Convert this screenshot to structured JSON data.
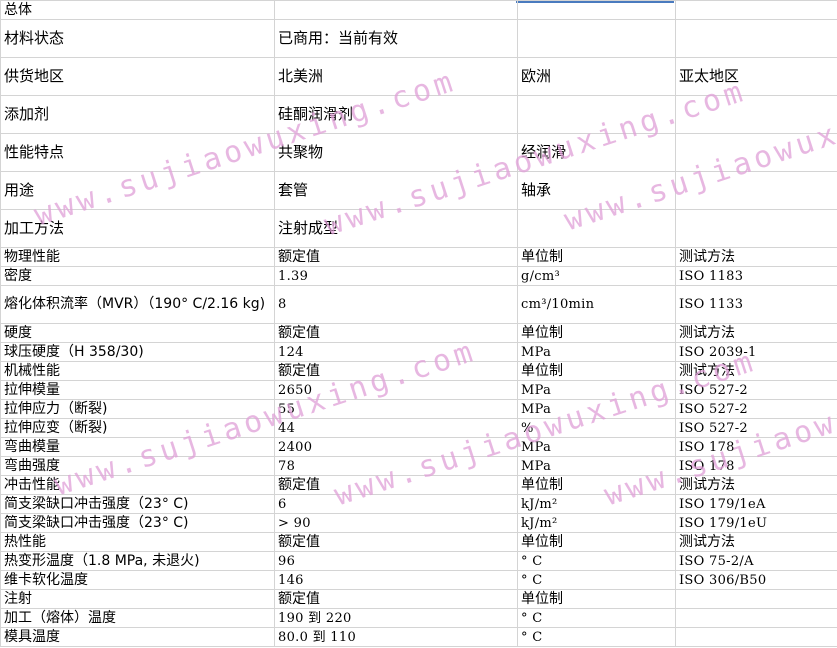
{
  "watermark": "www.sujiaowuxing.com",
  "rows": [
    {
      "cells": [
        "总体",
        "",
        "",
        ""
      ]
    },
    {
      "cells": [
        "材料状态",
        "已商用：当前有效",
        "",
        ""
      ]
    },
    {
      "cells": [
        "供货地区",
        "北美洲",
        "欧洲",
        "亚太地区"
      ]
    },
    {
      "cells": [
        "添加剂",
        "硅酮润滑剂",
        "",
        ""
      ]
    },
    {
      "cells": [
        "性能特点",
        "共聚物",
        "经润滑",
        ""
      ]
    },
    {
      "cells": [
        "用途",
        "套管",
        "轴承",
        ""
      ]
    },
    {
      "cells": [
        "加工方法",
        "注射成型",
        "",
        ""
      ]
    },
    {
      "cells": [
        "物理性能",
        "额定值",
        "单位制",
        "测试方法"
      ]
    },
    {
      "cells": [
        "密度",
        "1.39",
        "g/cm³",
        "ISO 1183"
      ]
    },
    {
      "cells": [
        "熔化体积流率（MVR）（190° C/2.16 kg)",
        "8",
        "cm³/10min",
        "ISO 1133"
      ]
    },
    {
      "cells": [
        "硬度",
        "额定值",
        "单位制",
        "测试方法"
      ]
    },
    {
      "cells": [
        "球压硬度（H 358/30)",
        "124",
        "MPa",
        "ISO 2039-1"
      ]
    },
    {
      "cells": [
        "机械性能",
        "额定值",
        "单位制",
        "测试方法"
      ]
    },
    {
      "cells": [
        "拉伸模量",
        "2650",
        "MPa",
        "ISO 527-2"
      ]
    },
    {
      "cells": [
        "拉伸应力（断裂)",
        "55",
        "MPa",
        "ISO 527-2"
      ]
    },
    {
      "cells": [
        "拉伸应变（断裂)",
        "44",
        "%",
        "ISO 527-2"
      ]
    },
    {
      "cells": [
        "弯曲模量",
        "2400",
        "MPa",
        "ISO 178"
      ]
    },
    {
      "cells": [
        "弯曲强度",
        "78",
        "MPa",
        "ISO 178"
      ]
    },
    {
      "cells": [
        "冲击性能",
        "额定值",
        "单位制",
        "测试方法"
      ]
    },
    {
      "cells": [
        "简支梁缺口冲击强度（23° C)",
        "6",
        "kJ/m²",
        "ISO 179/1eA"
      ]
    },
    {
      "cells": [
        "简支梁缺口冲击强度（23° C)",
        "> 90",
        "kJ/m²",
        "ISO 179/1eU"
      ]
    },
    {
      "cells": [
        "热性能",
        "额定值",
        "单位制",
        "测试方法"
      ]
    },
    {
      "cells": [
        "热变形温度（1.8 MPa, 未退火)",
        "96",
        "° C",
        "ISO 75-2/A"
      ]
    },
    {
      "cells": [
        "维卡软化温度",
        "146",
        "° C",
        "ISO 306/B50"
      ]
    },
    {
      "cells": [
        "注射",
        "额定值",
        "单位制",
        ""
      ]
    },
    {
      "cells": [
        "加工（熔体）温度",
        "190 到 220",
        "° C",
        ""
      ]
    },
    {
      "cells": [
        "模具温度",
        "80.0 到 110",
        "° C",
        ""
      ]
    }
  ]
}
